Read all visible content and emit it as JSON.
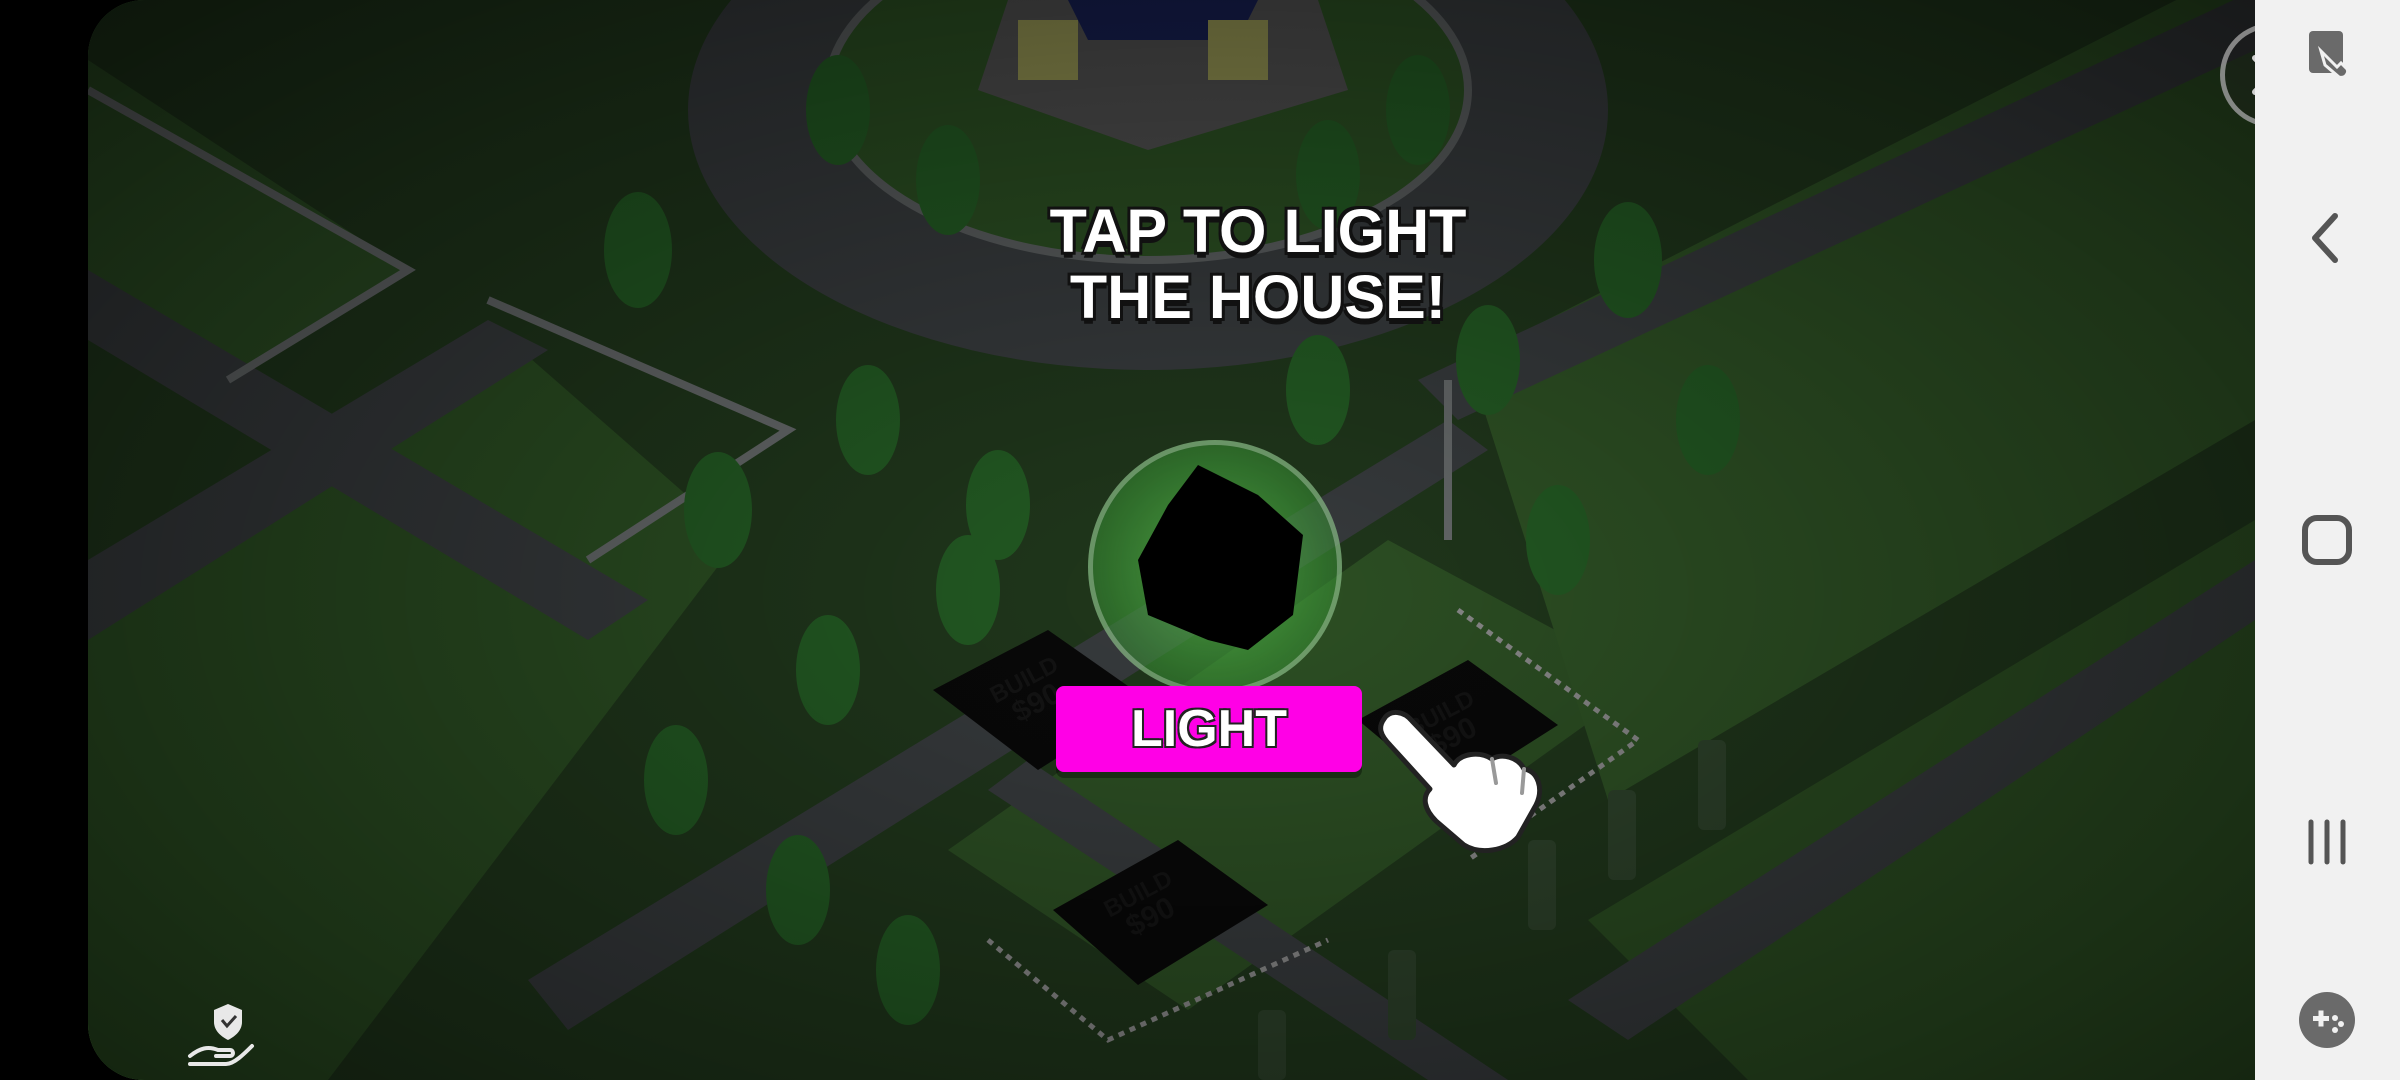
{
  "game": {
    "instruction": "TAP TO LIGHT\nTHE HOUSE!",
    "light_button_label": "LIGHT",
    "build_plots": [
      {
        "label": "BUILD",
        "price": "$90"
      },
      {
        "label": "BUILD",
        "price": "$90"
      },
      {
        "label": "BUILD",
        "price": "$90"
      }
    ],
    "icons": {
      "close": "close-icon",
      "hand": "hand-pointer-icon",
      "privacy": "privacy-shield-hand-icon"
    }
  },
  "navigation_bar": {
    "buttons": [
      {
        "icon": "screen-touch-icon"
      },
      {
        "icon": "back-icon"
      },
      {
        "icon": "home-icon"
      },
      {
        "icon": "recent-apps-icon"
      },
      {
        "icon": "game-controller-icon"
      }
    ]
  },
  "colors": {
    "light_button": "#ff00e6",
    "spotlight": "#5abe50",
    "navbar": "#f1f1f1"
  }
}
